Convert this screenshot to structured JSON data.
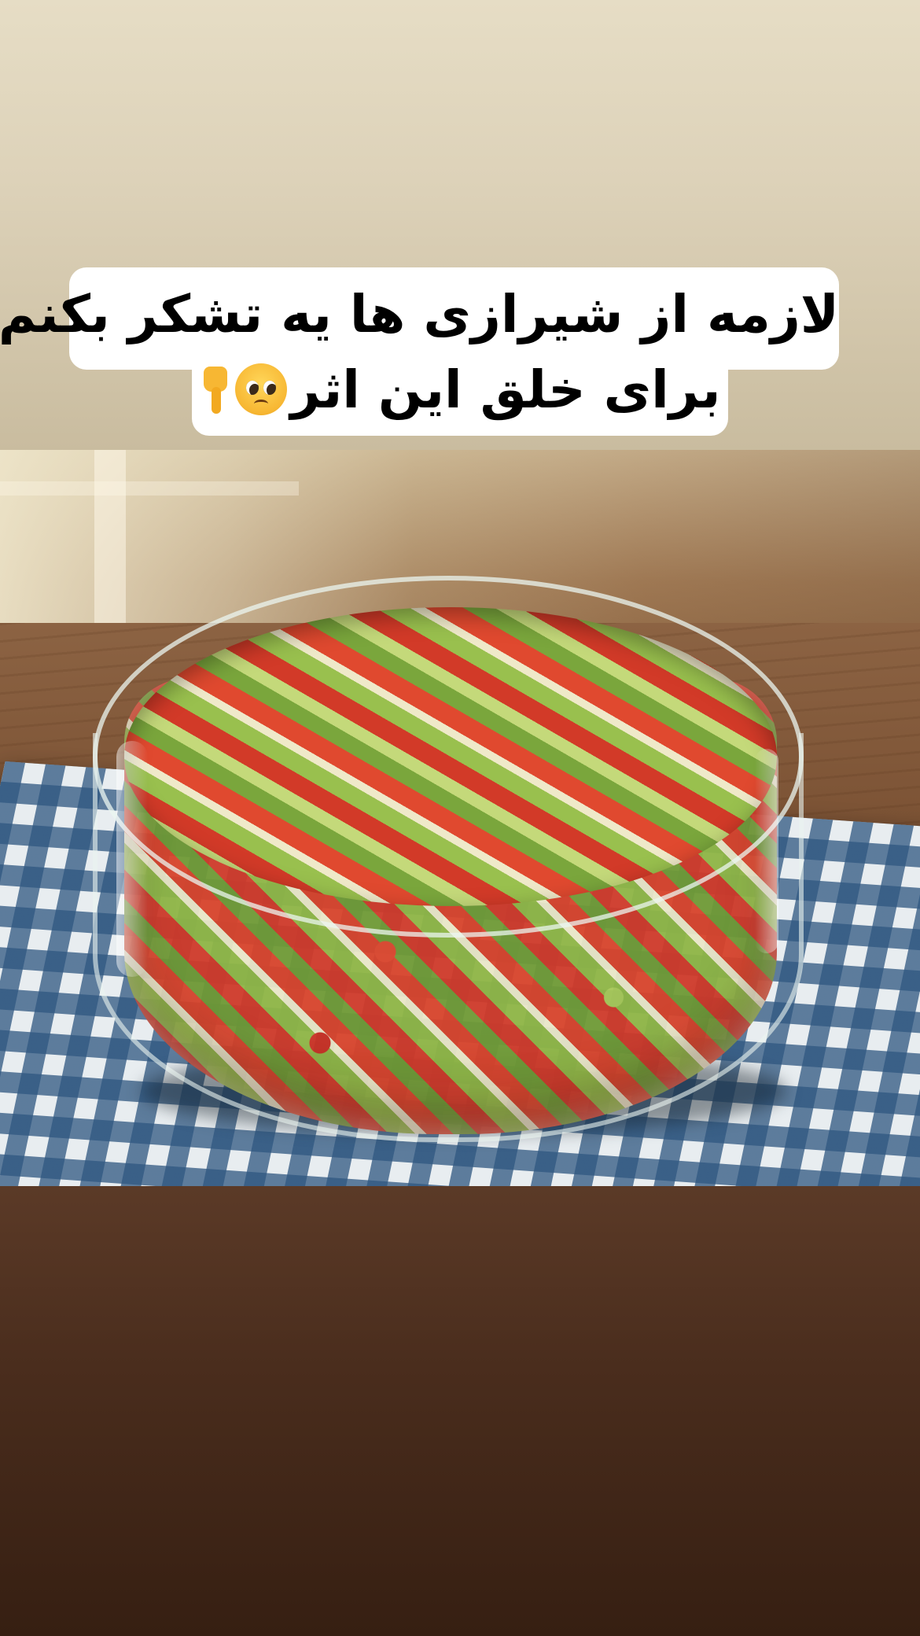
{
  "story": {
    "caption_line1": "لازمه از شیرازی ها یه تشکر بکنم",
    "caption_line2": "برای خلق این اثر",
    "caption_emojis": [
      "pleading-face-emoji",
      "backhand-index-pointing-down-emoji"
    ]
  },
  "photo": {
    "subject": "shirazi-salad-bowl-photo"
  },
  "colors": {
    "top_background": "#ddd3bb",
    "bottom_background": "#4a2d1d",
    "caption_box": "#ffffff",
    "caption_text": "#000000"
  }
}
